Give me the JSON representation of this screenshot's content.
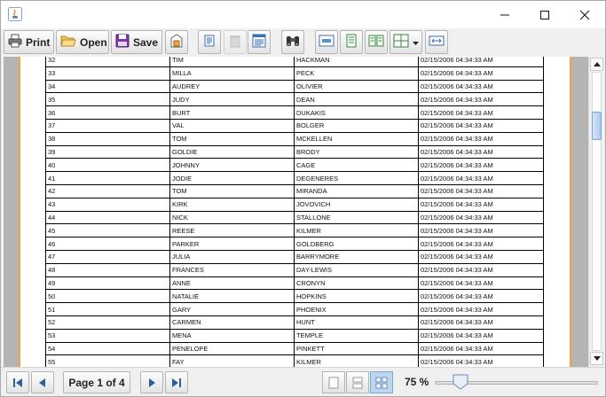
{
  "window": {
    "controls": {
      "minimize": "minimize-icon",
      "maximize": "maximize-icon",
      "close": "close-icon"
    }
  },
  "toolbar": {
    "print_label": "Print",
    "open_label": "Open",
    "save_label": "Save"
  },
  "report": {
    "rows": [
      [
        "32",
        "TIM",
        "HACKMAN",
        "02/15/2006 04:34:33 AM"
      ],
      [
        "33",
        "MILLA",
        "PECK",
        "02/15/2006 04:34:33 AM"
      ],
      [
        "34",
        "AUDREY",
        "OLIVIER",
        "02/15/2006 04:34:33 AM"
      ],
      [
        "35",
        "JUDY",
        "DEAN",
        "02/15/2006 04:34:33 AM"
      ],
      [
        "36",
        "BURT",
        "DUKAKIS",
        "02/15/2006 04:34:33 AM"
      ],
      [
        "37",
        "VAL",
        "BOLGER",
        "02/15/2006 04:34:33 AM"
      ],
      [
        "38",
        "TOM",
        "MCKELLEN",
        "02/15/2006 04:34:33 AM"
      ],
      [
        "39",
        "GOLDIE",
        "BRODY",
        "02/15/2006 04:34:33 AM"
      ],
      [
        "40",
        "JOHNNY",
        "CAGE",
        "02/15/2006 04:34:33 AM"
      ],
      [
        "41",
        "JODIE",
        "DEGENERES",
        "02/15/2006 04:34:33 AM"
      ],
      [
        "42",
        "TOM",
        "MIRANDA",
        "02/15/2006 04:34:33 AM"
      ],
      [
        "43",
        "KIRK",
        "JOVOVICH",
        "02/15/2006 04:34:33 AM"
      ],
      [
        "44",
        "NICK",
        "STALLONE",
        "02/15/2006 04:34:33 AM"
      ],
      [
        "45",
        "REESE",
        "KILMER",
        "02/15/2006 04:34:33 AM"
      ],
      [
        "46",
        "PARKER",
        "GOLDBERG",
        "02/15/2006 04:34:33 AM"
      ],
      [
        "47",
        "JULIA",
        "BARRYMORE",
        "02/15/2006 04:34:33 AM"
      ],
      [
        "48",
        "FRANCES",
        "DAY-LEWIS",
        "02/15/2006 04:34:33 AM"
      ],
      [
        "49",
        "ANNE",
        "CRONYN",
        "02/15/2006 04:34:33 AM"
      ],
      [
        "50",
        "NATALIE",
        "HOPKINS",
        "02/15/2006 04:34:33 AM"
      ],
      [
        "51",
        "GARY",
        "PHOENIX",
        "02/15/2006 04:34:33 AM"
      ],
      [
        "52",
        "CARMEN",
        "HUNT",
        "02/15/2006 04:34:33 AM"
      ],
      [
        "53",
        "MENA",
        "TEMPLE",
        "02/15/2006 04:34:33 AM"
      ],
      [
        "54",
        "PENELOPE",
        "PINKETT",
        "02/15/2006 04:34:33 AM"
      ],
      [
        "55",
        "FAY",
        "KILMER",
        "02/15/2006 04:34:33 AM"
      ]
    ]
  },
  "status": {
    "page_indicator": "Page 1 of 4",
    "zoom_label": "75 %",
    "zoom_level_percent": 75
  },
  "colors": {
    "page_border": "#f5a347",
    "viewport_bg": "#b4b4b4",
    "accent": "#7fa6d3"
  }
}
